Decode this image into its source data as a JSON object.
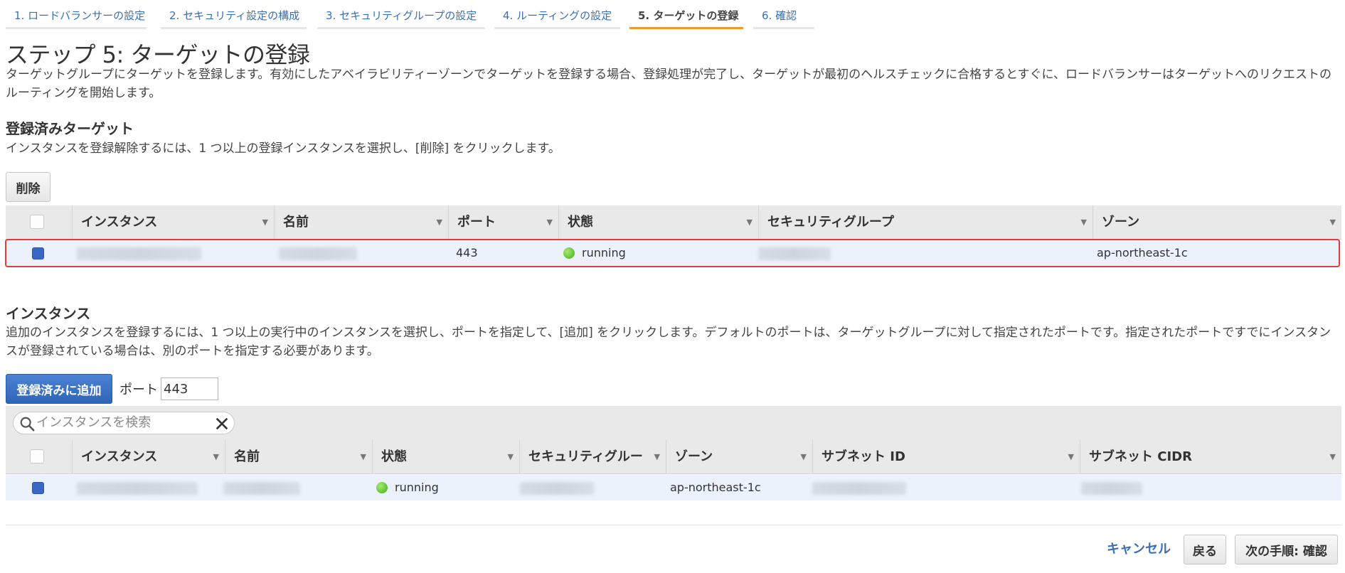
{
  "tabs": [
    {
      "label": "1. ロードバランサーの設定"
    },
    {
      "label": "2. セキュリティ設定の構成"
    },
    {
      "label": "3. セキュリティグループの設定"
    },
    {
      "label": "4. ルーティングの設定"
    },
    {
      "label": "5. ターゲットの登録"
    },
    {
      "label": "6. 確認"
    }
  ],
  "page": {
    "title": "ステップ 5: ターゲットの登録",
    "description": "ターゲットグループにターゲットを登録します。有効にしたアベイラビリティーゾーンでターゲットを登録する場合、登録処理が完了し、ターゲットが最初のヘルスチェックに合格するとすぐに、ロードバランサーはターゲットへのリクエストのルーティングを開始します。"
  },
  "registered": {
    "heading": "登録済みターゲット",
    "description": "インスタンスを登録解除するには、1 つ以上の登録インスタンスを選択し、[削除] をクリックします。",
    "remove_button": "削除",
    "columns": [
      "インスタンス",
      "名前",
      "ポート",
      "状態",
      "セキュリティグループ",
      "ゾーン"
    ],
    "rows": [
      {
        "port": "443",
        "state": "running",
        "zone": "ap-northeast-1c"
      }
    ]
  },
  "instances": {
    "heading": "インスタンス",
    "description": "追加のインスタンスを登録するには、1 つ以上の実行中のインスタンスを選択し、ポートを指定して、[追加] をクリックします。デフォルトのポートは、ターゲットグループに対して指定されたポートです。指定されたポートですでにインスタンスが登録されている場合は、別のポートを指定する必要があります。",
    "add_button": "登録済みに追加",
    "port_label": "ポート",
    "port_value": "443",
    "search_placeholder": "インスタンスを検索",
    "columns": [
      "インスタンス",
      "名前",
      "状態",
      "セキュリティグルー",
      "ゾーン",
      "サブネット ID",
      "サブネット CIDR"
    ],
    "rows": [
      {
        "state": "running",
        "zone": "ap-northeast-1c"
      }
    ]
  },
  "footer": {
    "cancel": "キャンセル",
    "back": "戻る",
    "next": "次の手順: 確認"
  },
  "colors": {
    "accent": "#3a6fb3",
    "active_tab_underline": "#ec9b2a",
    "primary_button": "#2f65b8",
    "highlight_border": "#e23c3c",
    "running_dot": "#3fae1d"
  }
}
